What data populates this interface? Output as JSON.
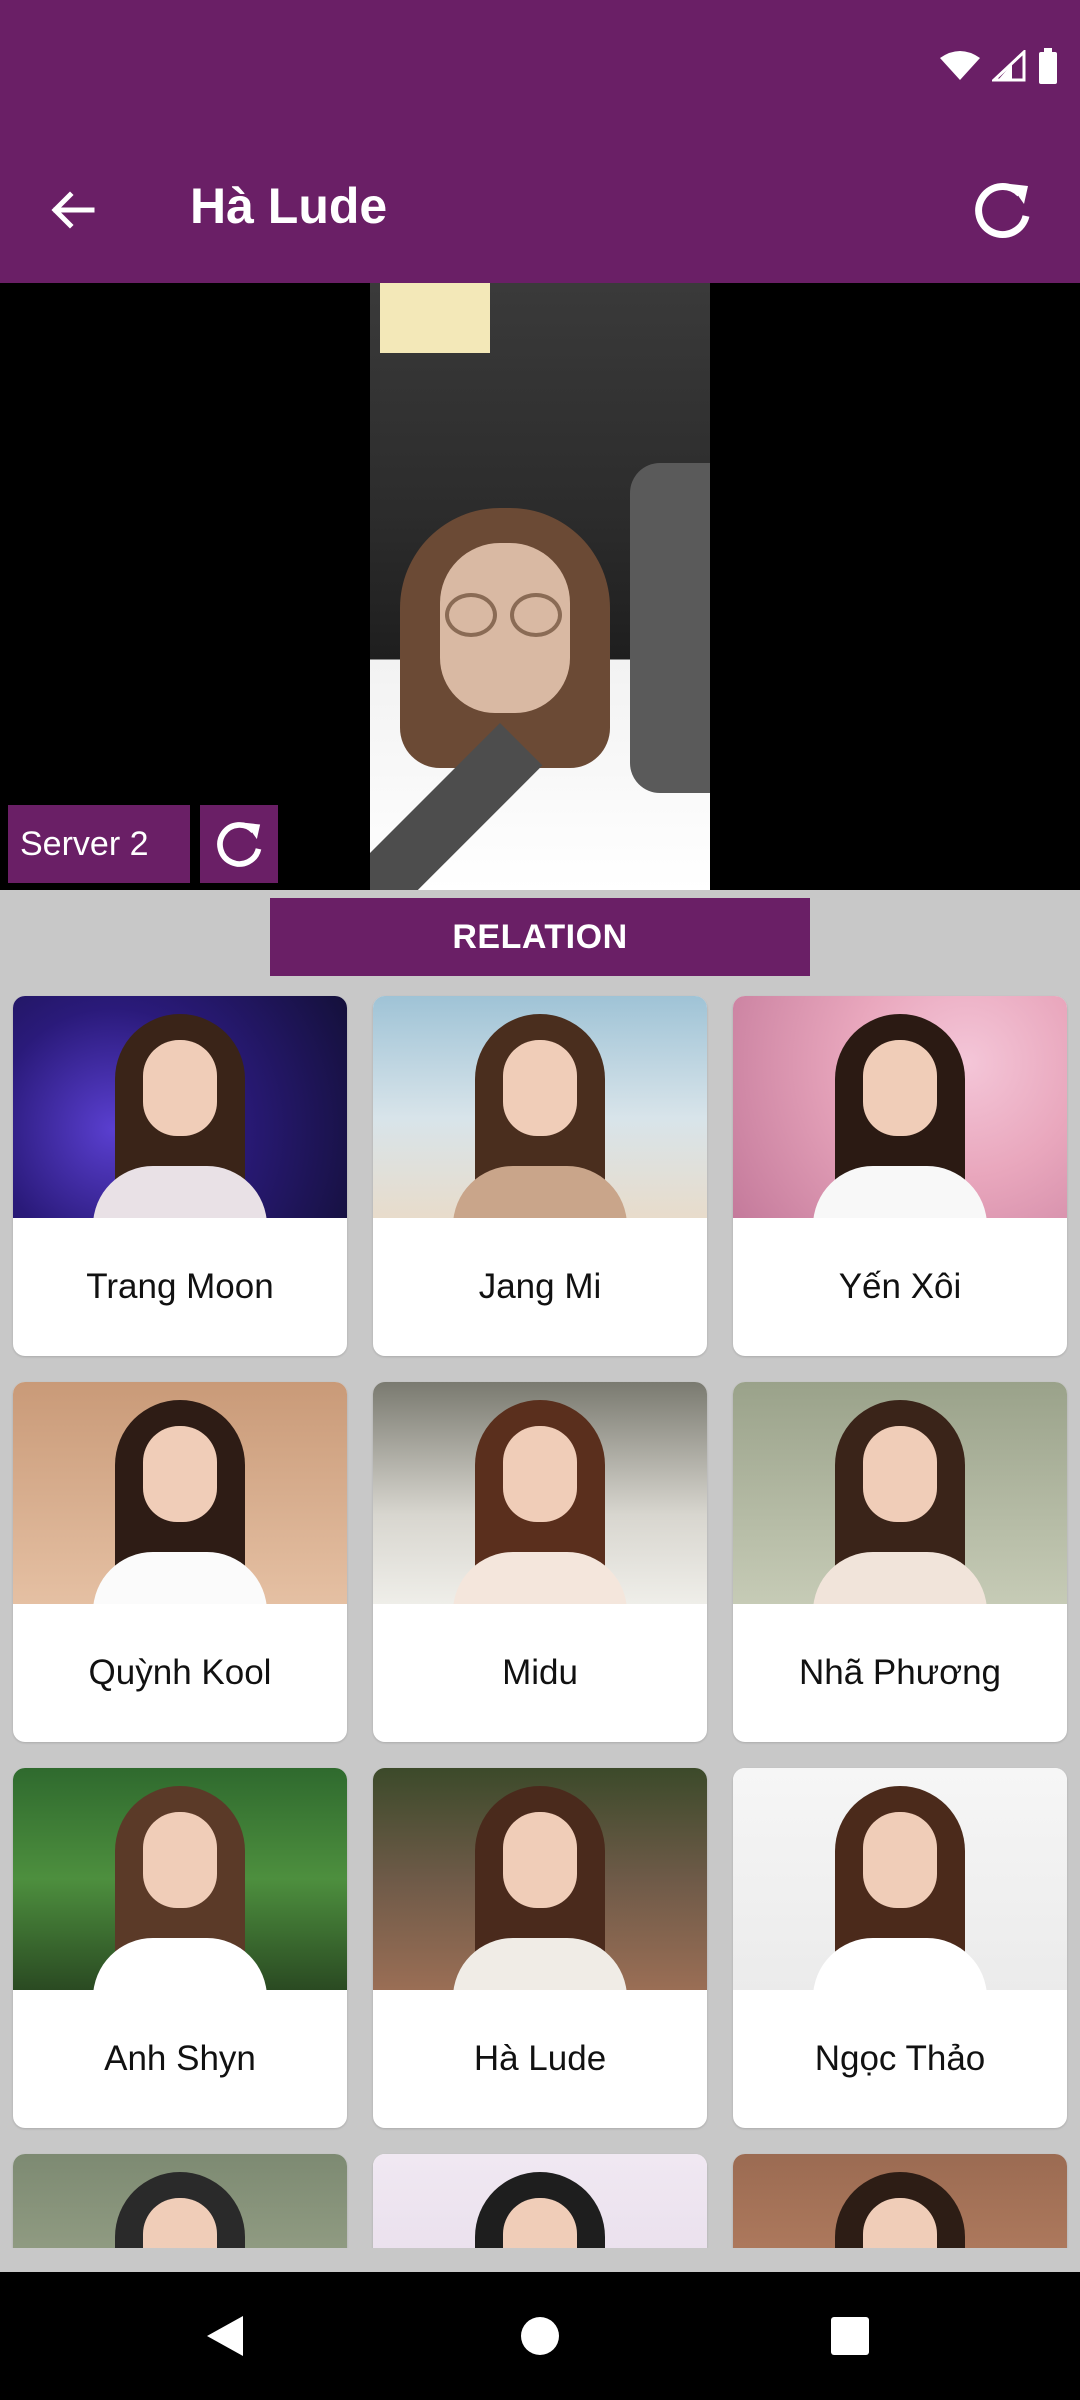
{
  "app_bar": {
    "title": "Hà Lude"
  },
  "video": {
    "server_label": "Server 2"
  },
  "section": {
    "relation_label": "RELATION"
  },
  "colors": {
    "primary": "#6a1f66",
    "background": "#c8c8c8",
    "card": "#ffffff"
  },
  "icons": {
    "back": "arrow-left-icon",
    "refresh": "refresh-icon",
    "wifi": "wifi-icon",
    "signal": "signal-icon",
    "battery": "battery-icon",
    "nav_back": "triangle-back-icon",
    "nav_home": "circle-home-icon",
    "nav_recents": "square-recents-icon"
  },
  "relations": [
    {
      "name": "Trang Moon"
    },
    {
      "name": "Jang Mi"
    },
    {
      "name": "Yến Xôi"
    },
    {
      "name": "Quỳnh Kool"
    },
    {
      "name": "Midu"
    },
    {
      "name": "Nhã Phương"
    },
    {
      "name": "Anh Shyn"
    },
    {
      "name": "Hà Lude"
    },
    {
      "name": "Ngọc Thảo"
    },
    {
      "name": ""
    },
    {
      "name": ""
    },
    {
      "name": ""
    }
  ]
}
